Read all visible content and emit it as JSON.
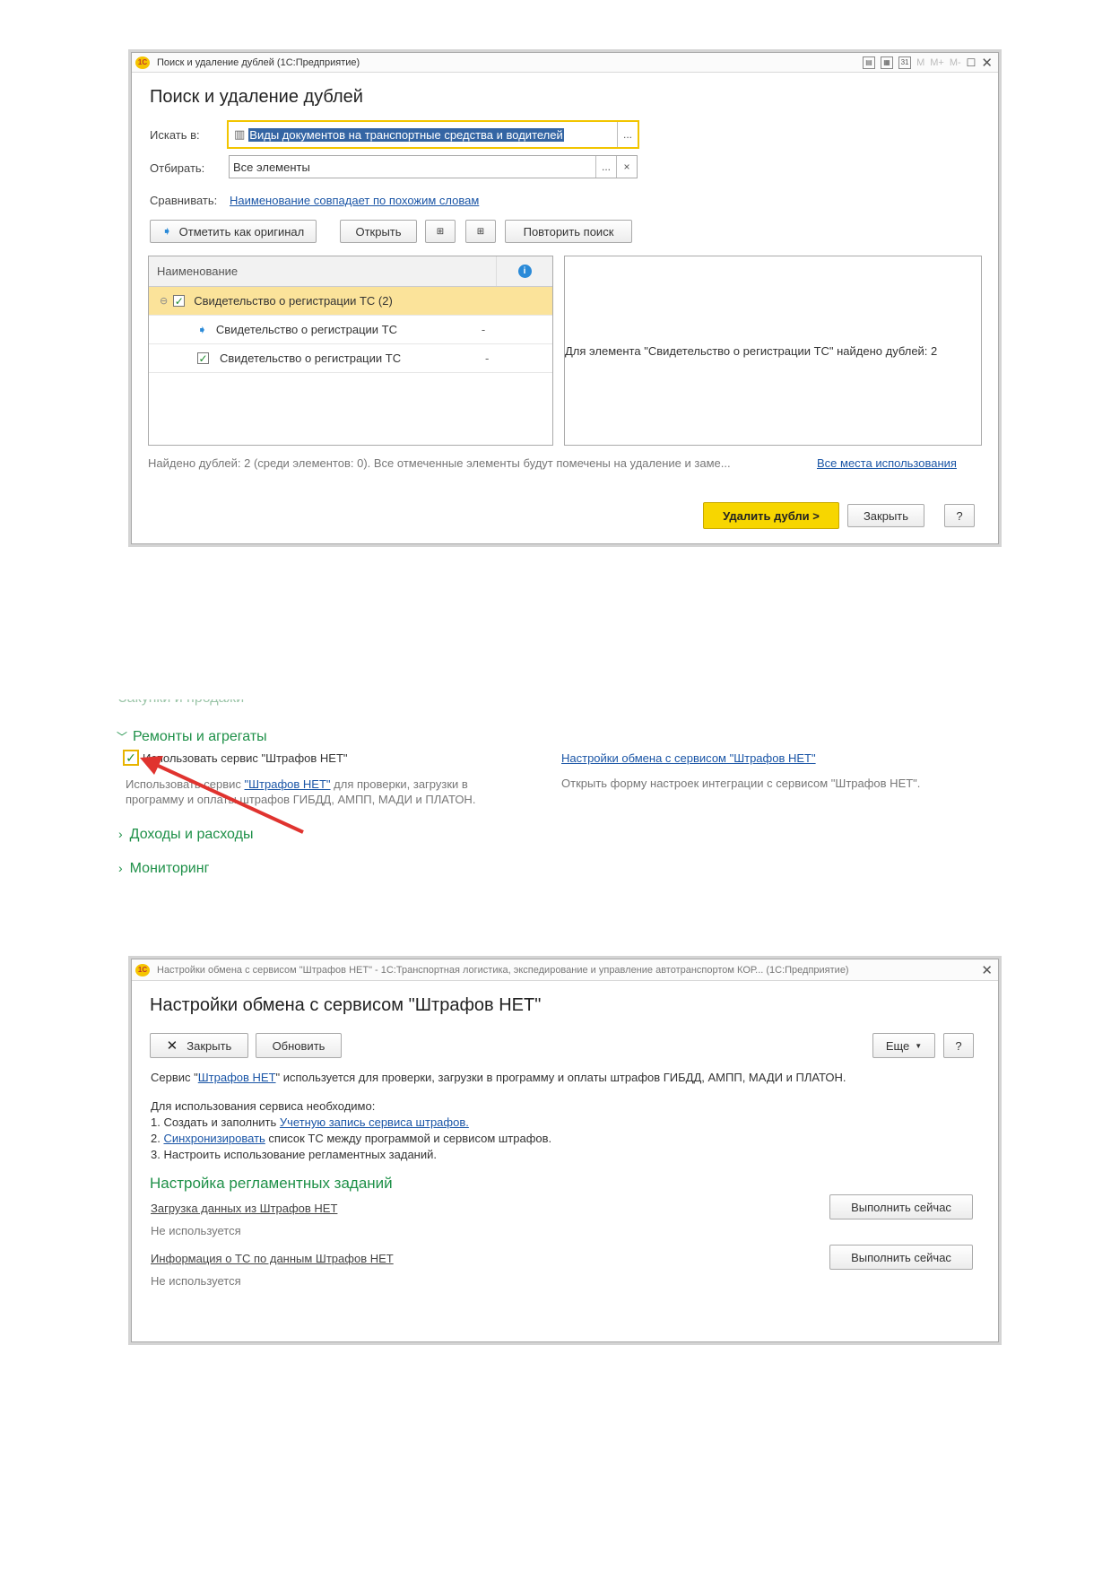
{
  "win1": {
    "title": "Поиск и удаление дублей  (1С:Предприятие)",
    "form_title": "Поиск и удаление дублей",
    "search_in_label": "Искать в:",
    "search_in_value": "Виды документов на транспортные средства и водителей",
    "filter_label": "Отбирать:",
    "filter_value": "Все элементы",
    "compare_label": "Сравнивать:",
    "compare_link": "Наименование совпадает по похожим словам",
    "mark_original": "Отметить как оригинал",
    "open": "Открыть",
    "repeat_search": "Повторить поиск",
    "col_name": "Наименование",
    "group_row": "Свидетельство о регистрации ТС (2)",
    "row1": "Свидетельство о регистрации ТС",
    "row1_val": "-",
    "row2": "Свидетельство о регистрации ТС",
    "row2_val": "-",
    "detail_text": "Для элемента \"Свидетельство о регистрации ТС\" найдено дублей: 2",
    "status_text": "Найдено дублей: 2 (среди элементов: 0). Все отмеченные элементы будут помечены на удаление и заме...",
    "all_usages": "Все места использования",
    "delete_btn": "Удалить дубли >",
    "close_btn": "Закрыть",
    "help_btn": "?"
  },
  "settings": {
    "cut_heading": "Закупки и продажи",
    "section_repairs": "Ремонты и агрегаты",
    "use_service_label": "Использовать сервис \"Штрафов НЕТ\"",
    "desc_pre": "Использовать сервис ",
    "desc_link": "\"Штрафов НЕТ\"",
    "desc_post": " для проверки, загрузки в",
    "desc_line2": "программу и оплаты штрафов ГИБДД, АМПП, МАДИ и ПЛАТОН.",
    "exchange_link": "Настройки обмена с сервисом \"Штрафов НЕТ\"",
    "exchange_desc": "Открыть форму настроек интеграции с сервисом \"Штрафов НЕТ\".",
    "section_income": "Доходы и расходы",
    "section_monitoring": "Мониторинг"
  },
  "win2": {
    "title": "Настройки обмена с сервисом \"Штрафов НЕТ\" - 1С:Транспортная логистика, экспедирование и управление автотранспортом КОР...  (1С:Предприятие)",
    "form_title": "Настройки обмена с сервисом \"Штрафов НЕТ\"",
    "close_btn": "Закрыть",
    "refresh_btn": "Обновить",
    "more_btn": "Еще",
    "help_btn": "?",
    "service_pre": "Сервис \"",
    "service_link": "Штрафов НЕТ",
    "service_post": "\" используется для проверки, загрузки в программу и оплаты штрафов ГИБДД, АМПП, МАДИ и ПЛАТОН.",
    "need_title": "Для использования сервиса необходимо:",
    "step1_pre": "1. Создать и заполнить ",
    "step1_link": "Учетную запись сервиса штрафов.",
    "step2_pre": "2. ",
    "step2_link": "Синхронизировать",
    "step2_post": " список ТС между программой и сервисом штрафов.",
    "step3": "3. Настроить использование регламентных заданий.",
    "jobs_header": "Настройка регламентных заданий",
    "job1_link": "Загрузка данных из Штрафов НЕТ",
    "job1_status": "Не используется",
    "job2_link": "Информация о ТС по данным Штрафов НЕТ",
    "job2_status": "Не используется",
    "run_now": "Выполнить сейчас"
  },
  "colors": {
    "accent_yellow": "#f7d600",
    "link_blue": "#1a55a6",
    "section_green": "#1e9048",
    "arrow_red": "#e0332f"
  }
}
